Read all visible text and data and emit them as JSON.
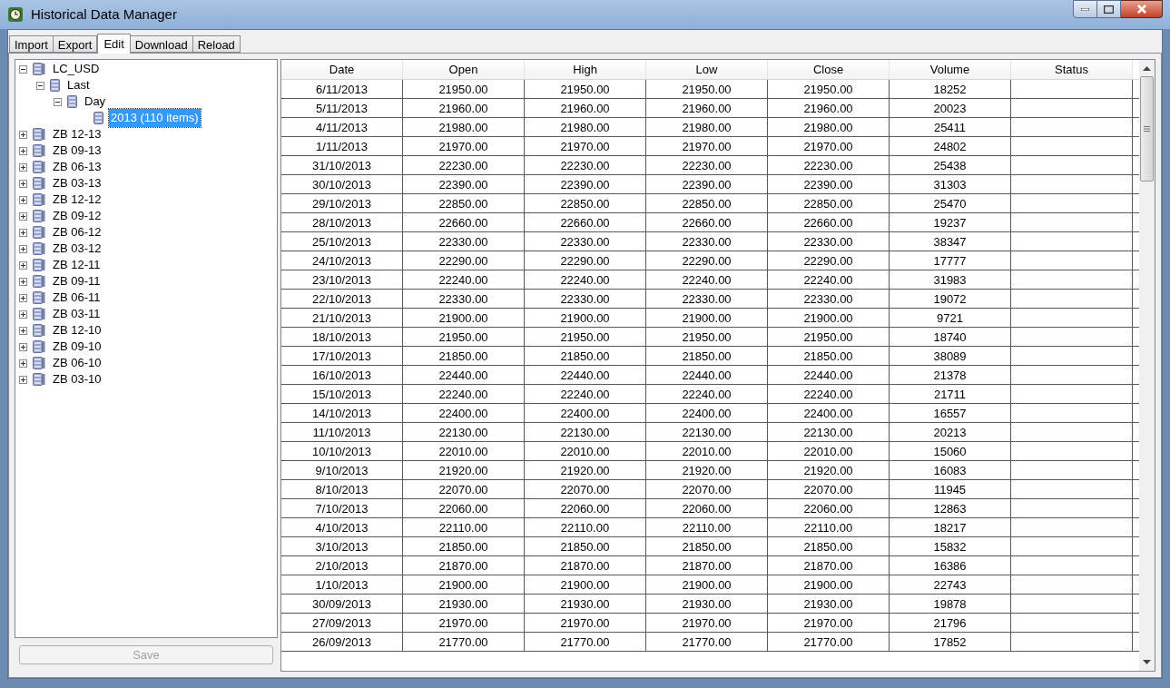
{
  "window": {
    "title": "Historical Data Manager"
  },
  "tabs": [
    {
      "label": "Import",
      "selected": false
    },
    {
      "label": "Export",
      "selected": false
    },
    {
      "label": "Edit",
      "selected": true
    },
    {
      "label": "Download",
      "selected": false
    },
    {
      "label": "Reload",
      "selected": false
    }
  ],
  "tree": [
    {
      "label": "LC_USD",
      "expanded": true,
      "selected": false,
      "children": [
        {
          "label": "Last",
          "expanded": true,
          "selected": false,
          "children": [
            {
              "label": "Day",
              "expanded": true,
              "selected": false,
              "children": [
                {
                  "label": "2013 (110 items)",
                  "selected": true
                }
              ]
            }
          ]
        }
      ]
    },
    {
      "label": "ZB 12-13",
      "expanded": false,
      "selected": false
    },
    {
      "label": "ZB 09-13",
      "expanded": false,
      "selected": false
    },
    {
      "label": "ZB 06-13",
      "expanded": false,
      "selected": false
    },
    {
      "label": "ZB 03-13",
      "expanded": false,
      "selected": false
    },
    {
      "label": "ZB 12-12",
      "expanded": false,
      "selected": false
    },
    {
      "label": "ZB 09-12",
      "expanded": false,
      "selected": false
    },
    {
      "label": "ZB 06-12",
      "expanded": false,
      "selected": false
    },
    {
      "label": "ZB 03-12",
      "expanded": false,
      "selected": false
    },
    {
      "label": "ZB 12-11",
      "expanded": false,
      "selected": false
    },
    {
      "label": "ZB 09-11",
      "expanded": false,
      "selected": false
    },
    {
      "label": "ZB 06-11",
      "expanded": false,
      "selected": false
    },
    {
      "label": "ZB 03-11",
      "expanded": false,
      "selected": false
    },
    {
      "label": "ZB 12-10",
      "expanded": false,
      "selected": false
    },
    {
      "label": "ZB 09-10",
      "expanded": false,
      "selected": false
    },
    {
      "label": "ZB 06-10",
      "expanded": false,
      "selected": false
    },
    {
      "label": "ZB 03-10",
      "expanded": false,
      "selected": false
    }
  ],
  "save_button": {
    "label": "Save",
    "disabled": true
  },
  "table": {
    "columns": [
      "Date",
      "Open",
      "High",
      "Low",
      "Close",
      "Volume",
      "Status"
    ],
    "rows": [
      [
        "6/11/2013",
        "21950.00",
        "21950.00",
        "21950.00",
        "21950.00",
        "18252"
      ],
      [
        "5/11/2013",
        "21960.00",
        "21960.00",
        "21960.00",
        "21960.00",
        "20023"
      ],
      [
        "4/11/2013",
        "21980.00",
        "21980.00",
        "21980.00",
        "21980.00",
        "25411"
      ],
      [
        "1/11/2013",
        "21970.00",
        "21970.00",
        "21970.00",
        "21970.00",
        "24802"
      ],
      [
        "31/10/2013",
        "22230.00",
        "22230.00",
        "22230.00",
        "22230.00",
        "25438"
      ],
      [
        "30/10/2013",
        "22390.00",
        "22390.00",
        "22390.00",
        "22390.00",
        "31303"
      ],
      [
        "29/10/2013",
        "22850.00",
        "22850.00",
        "22850.00",
        "22850.00",
        "25470"
      ],
      [
        "28/10/2013",
        "22660.00",
        "22660.00",
        "22660.00",
        "22660.00",
        "19237"
      ],
      [
        "25/10/2013",
        "22330.00",
        "22330.00",
        "22330.00",
        "22330.00",
        "38347"
      ],
      [
        "24/10/2013",
        "22290.00",
        "22290.00",
        "22290.00",
        "22290.00",
        "17777"
      ],
      [
        "23/10/2013",
        "22240.00",
        "22240.00",
        "22240.00",
        "22240.00",
        "31983"
      ],
      [
        "22/10/2013",
        "22330.00",
        "22330.00",
        "22330.00",
        "22330.00",
        "19072"
      ],
      [
        "21/10/2013",
        "21900.00",
        "21900.00",
        "21900.00",
        "21900.00",
        "9721"
      ],
      [
        "18/10/2013",
        "21950.00",
        "21950.00",
        "21950.00",
        "21950.00",
        "18740"
      ],
      [
        "17/10/2013",
        "21850.00",
        "21850.00",
        "21850.00",
        "21850.00",
        "38089"
      ],
      [
        "16/10/2013",
        "22440.00",
        "22440.00",
        "22440.00",
        "22440.00",
        "21378"
      ],
      [
        "15/10/2013",
        "22240.00",
        "22240.00",
        "22240.00",
        "22240.00",
        "21711"
      ],
      [
        "14/10/2013",
        "22400.00",
        "22400.00",
        "22400.00",
        "22400.00",
        "16557"
      ],
      [
        "11/10/2013",
        "22130.00",
        "22130.00",
        "22130.00",
        "22130.00",
        "20213"
      ],
      [
        "10/10/2013",
        "22010.00",
        "22010.00",
        "22010.00",
        "22010.00",
        "15060"
      ],
      [
        "9/10/2013",
        "21920.00",
        "21920.00",
        "21920.00",
        "21920.00",
        "16083"
      ],
      [
        "8/10/2013",
        "22070.00",
        "22070.00",
        "22070.00",
        "22070.00",
        "11945"
      ],
      [
        "7/10/2013",
        "22060.00",
        "22060.00",
        "22060.00",
        "22060.00",
        "12863"
      ],
      [
        "4/10/2013",
        "22110.00",
        "22110.00",
        "22110.00",
        "22110.00",
        "18217"
      ],
      [
        "3/10/2013",
        "21850.00",
        "21850.00",
        "21850.00",
        "21850.00",
        "15832"
      ],
      [
        "2/10/2013",
        "21870.00",
        "21870.00",
        "21870.00",
        "21870.00",
        "16386"
      ],
      [
        "1/10/2013",
        "21900.00",
        "21900.00",
        "21900.00",
        "21900.00",
        "22743"
      ],
      [
        "30/09/2013",
        "21930.00",
        "21930.00",
        "21930.00",
        "21930.00",
        "19878"
      ],
      [
        "27/09/2013",
        "21970.00",
        "21970.00",
        "21970.00",
        "21970.00",
        "21796"
      ],
      [
        "26/09/2013",
        "21770.00",
        "21770.00",
        "21770.00",
        "21770.00",
        "17852"
      ]
    ]
  }
}
